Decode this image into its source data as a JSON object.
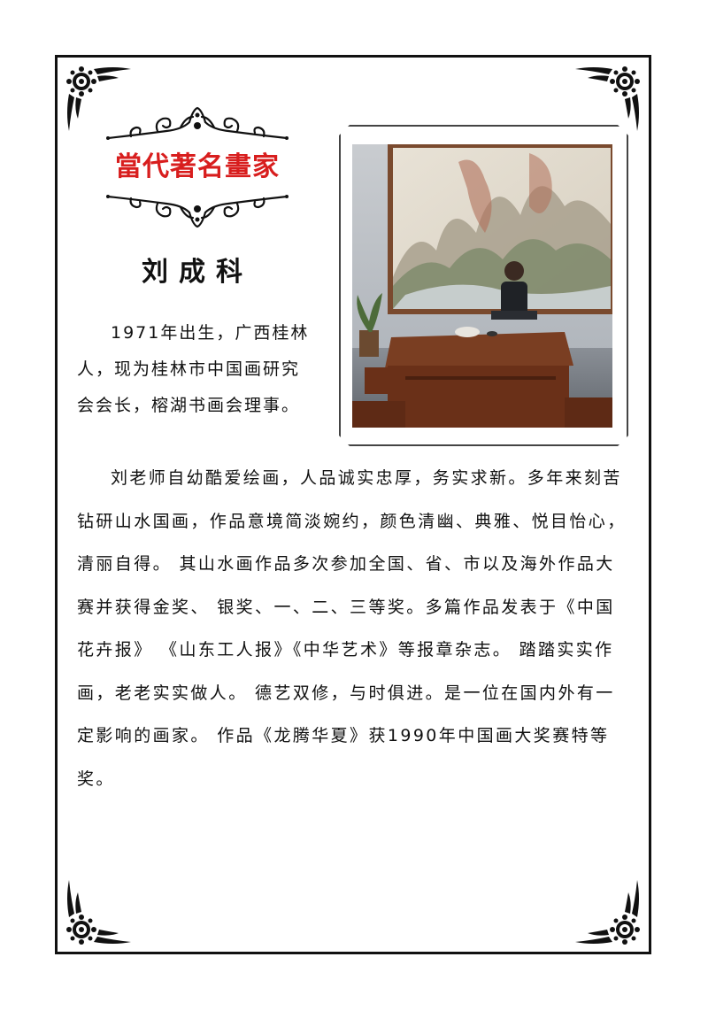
{
  "banner": {
    "title": "當代著名畫家"
  },
  "artist": {
    "name": "刘成科"
  },
  "intro": "1971年出生，广西桂林人，现为桂林市中国画研究会会长，榕湖书画会理事。",
  "body": "刘老师自幼酷爱绘画，人品诚实忠厚，务实求新。多年来刻苦钻研山水国画，作品意境简淡婉约，颜色清幽、典雅、悦目怡心，清丽自得。 其山水画作品多次参加全国、省、市以及海外作品大赛并获得金奖、 银奖、一、二、三等奖。多篇作品发表于《中国花卉报》 《山东工人报》《中华艺术》等报章杂志。 踏踏实实作画，老老实实做人。 德艺双修，与时俱进。是一位在国内外有一定影响的画家。  作品《龙腾华夏》获1990年中国画大奖赛特等奖。",
  "colors": {
    "title_red": "#d81e1e",
    "frame": "#111111"
  },
  "icons": [
    "corner-ornament-icon",
    "scroll-ornament-icon"
  ]
}
